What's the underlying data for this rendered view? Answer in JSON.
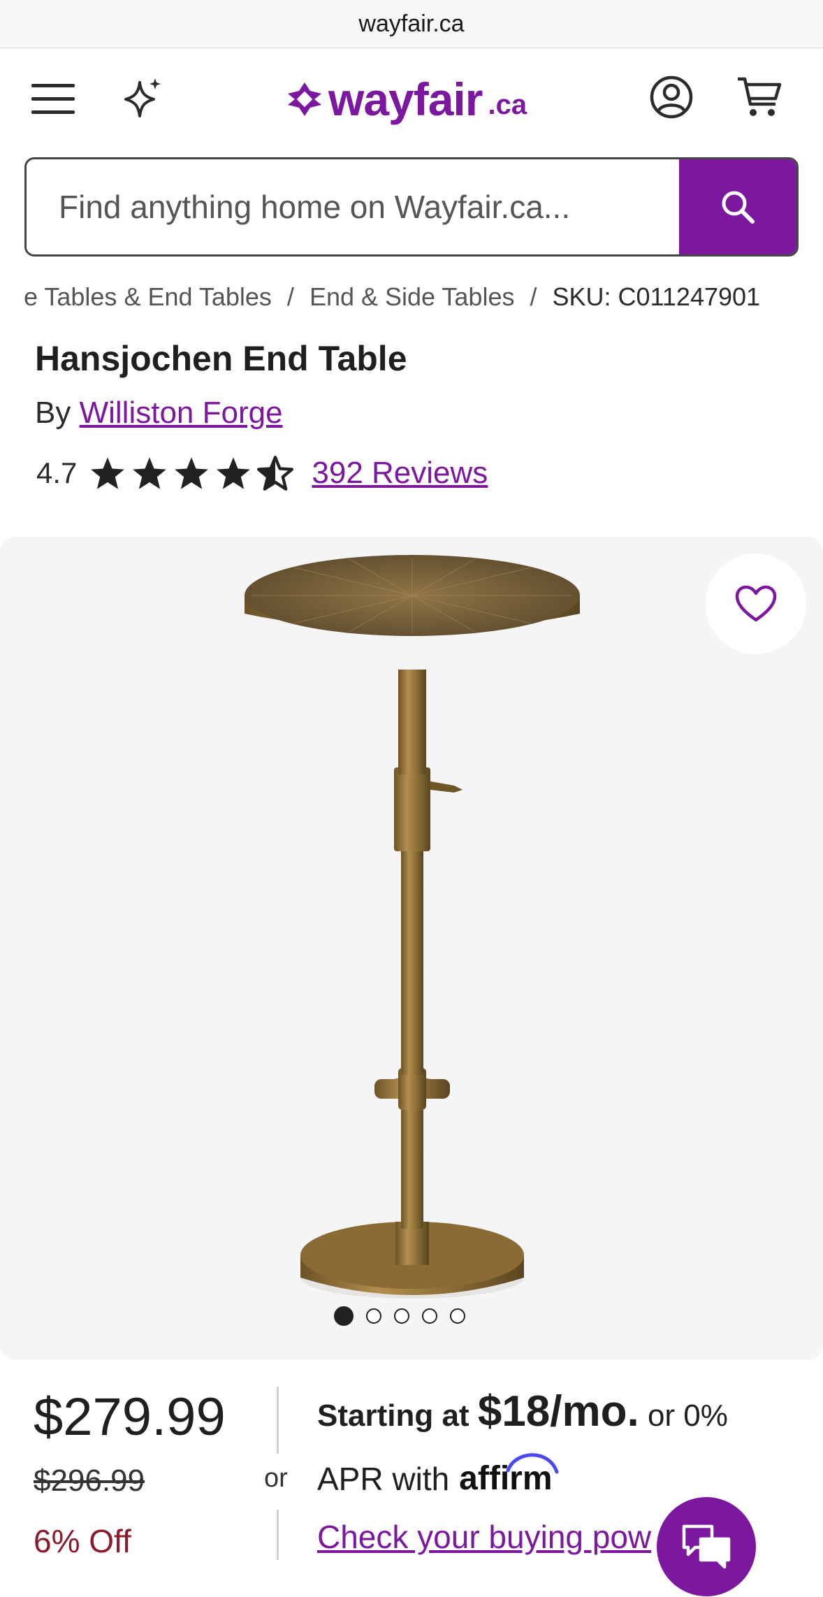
{
  "browser": {
    "url": "wayfair.ca"
  },
  "header": {
    "logo_word": "wayfair",
    "logo_suffix": ".ca"
  },
  "search": {
    "placeholder": "Find anything home on Wayfair.ca..."
  },
  "breadcrumbs": [
    "e Tables & End Tables",
    "/",
    "End & Side Tables",
    "/",
    "SKU: C011247901"
  ],
  "product": {
    "title": "Hansjochen End Table",
    "by_label": "By",
    "brand": "Williston Forge",
    "rating": "4.7",
    "rating_value": 4.7,
    "rating_max": 5,
    "reviews": "392 Reviews"
  },
  "gallery": {
    "image_count": 5,
    "active_index": 0
  },
  "pricing": {
    "current": "$279.99",
    "original": "$296.99",
    "discount": "6% Off",
    "or": "or",
    "financing_prefix": "Starting at",
    "financing_amount": "$18/mo.",
    "financing_suffix": "or 0%",
    "financing_line2": "APR with",
    "affirm": "affirm",
    "check_link": "Check your buying pow"
  },
  "colors": {
    "brand_purple": "#7b189f",
    "discount_red": "#8b1a2b"
  },
  "icons": [
    "menu-icon",
    "sparkle-icon",
    "account-icon",
    "cart-icon",
    "search-icon",
    "heart-icon",
    "chat-icon"
  ]
}
